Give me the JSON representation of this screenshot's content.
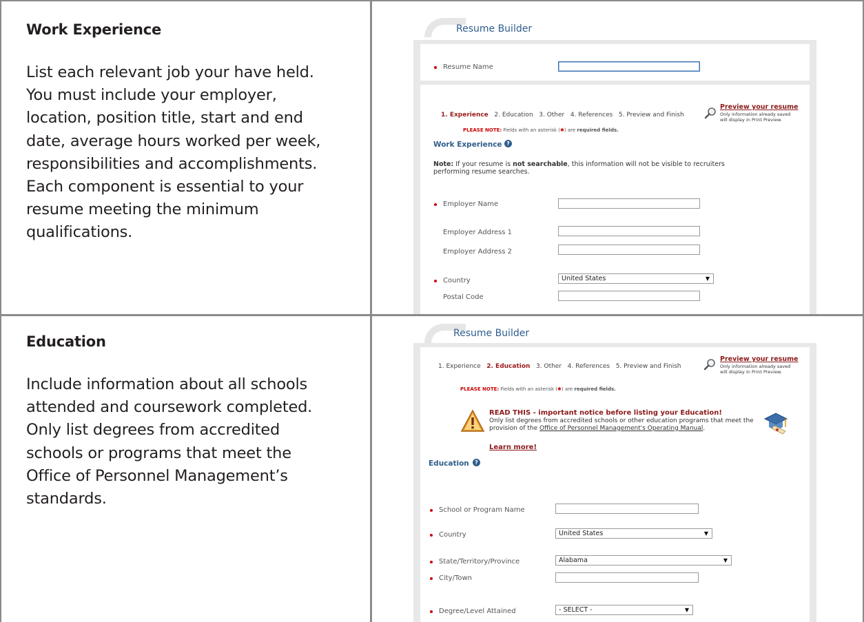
{
  "rows": [
    {
      "title": "Work Experience",
      "body": "List each relevant job your have held. You must include your employer, location, position title, start and end date, average hours worked per week, responsibilities and accomplishments. Each component is essential to your resume meeting the minimum qualifications."
    },
    {
      "title": "Education",
      "body": "Include information about all schools attended and coursework completed. Only list degrees from accredited schools or programs that meet the Office of Personnel Management’s standards."
    }
  ],
  "shot1": {
    "app_title": "Resume Builder",
    "resume_name_label": "Resume Name",
    "steps": {
      "s1": "1. Experience",
      "s2": "2. Education",
      "s3": "3. Other",
      "s4": "4. References",
      "s5": "5. Preview and Finish"
    },
    "preview_link": "Preview your resume",
    "preview_note": "Only information already saved will display in Print Preview.",
    "please_note": "PLEASE NOTE:",
    "please_note_rest_a": "Fields with an asterisk (",
    "please_note_star": "✱",
    "please_note_rest_b": ") are",
    "please_note_required": "required fields.",
    "section": "Work Experience",
    "help": "?",
    "note_lead": "Note:",
    "note_a": "If your resume is",
    "note_b": "not searchable",
    "note_c": ", this information will not be visible to recruiters performing resume searches.",
    "fields": {
      "employer_name": "Employer Name",
      "address1": "Employer Address 1",
      "address2": "Employer Address 2",
      "country": "Country",
      "country_value": "United States",
      "postal": "Postal Code"
    }
  },
  "shot2": {
    "app_title": "Resume Builder",
    "steps": {
      "s1": "1. Experience",
      "s2": "2. Education",
      "s3": "3. Other",
      "s4": "4. References",
      "s5": "5. Preview and Finish"
    },
    "preview_link": "Preview your resume",
    "preview_note": "Only information already saved will display in Print Preview.",
    "please_note": "PLEASE NOTE:",
    "please_note_rest_a": "Fields with an asterisk (",
    "please_note_star": "✱",
    "please_note_rest_b": ") are",
    "please_note_required": "required fields.",
    "notice_title": "READ THIS - important notice before listing your Education!",
    "notice_body_a": "Only list degrees from accredited schools or other education programs that meet the provision of the ",
    "notice_body_link": "Office of Personnel Management's Operating Manual",
    "notice_body_b": ".",
    "learn_more": "Learn more!",
    "section": "Education",
    "help": "?",
    "fields": {
      "school": "School or Program Name",
      "country": "Country",
      "country_value": "United States",
      "state": "State/Territory/Province",
      "state_value": "Alabama",
      "city": "City/Town",
      "degree": "Degree/Level Attained",
      "degree_value": "- SELECT -"
    }
  }
}
